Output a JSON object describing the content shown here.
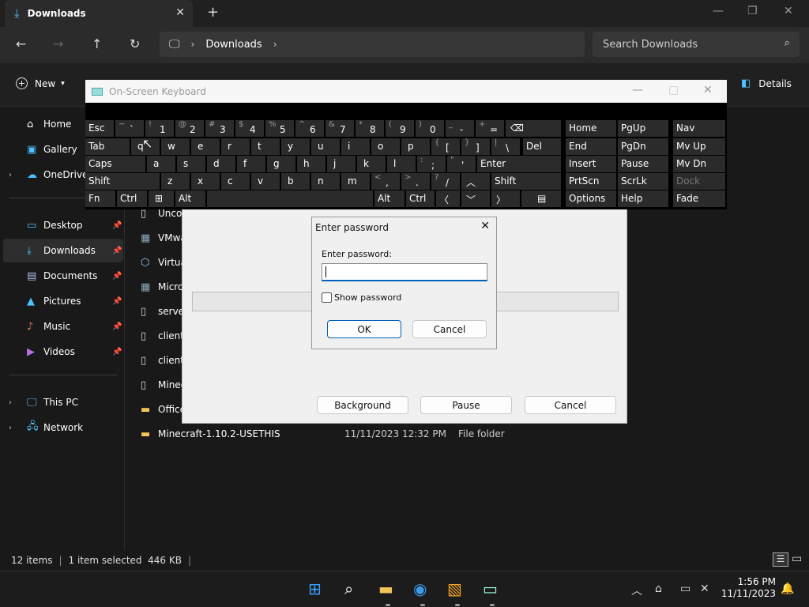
{
  "explorer": {
    "tab_title": "Downloads",
    "breadcrumb": "Downloads",
    "search_placeholder": "Search Downloads",
    "new_label": "New",
    "details_label": "Details",
    "sidebar": [
      {
        "label": "Home",
        "icon": "home-icon"
      },
      {
        "label": "Gallery",
        "icon": "gallery-icon"
      },
      {
        "label": "OneDrive",
        "icon": "onedrive-icon"
      },
      {
        "label": "Desktop",
        "icon": "desktop-icon"
      },
      {
        "label": "Downloads",
        "icon": "download-icon"
      },
      {
        "label": "Documents",
        "icon": "documents-icon"
      },
      {
        "label": "Pictures",
        "icon": "pictures-icon"
      },
      {
        "label": "Music",
        "icon": "music-icon"
      },
      {
        "label": "Videos",
        "icon": "videos-icon"
      },
      {
        "label": "This PC",
        "icon": "pc-icon"
      },
      {
        "label": "Network",
        "icon": "network-icon"
      }
    ],
    "files": [
      {
        "name": "Uncon"
      },
      {
        "name": "VMwa"
      },
      {
        "name": "Virtua"
      },
      {
        "name": "Micro"
      },
      {
        "name": "server"
      },
      {
        "name": "client"
      },
      {
        "name": "client."
      },
      {
        "name": "Minec"
      },
      {
        "name": "Office"
      },
      {
        "name": "Minecraft-1.10.2-USETHIS",
        "date": "11/11/2023 12:32 PM",
        "type": "File folder"
      }
    ],
    "status": {
      "items": "12 items",
      "selected": "1 item selected  446 KB"
    }
  },
  "progress_window": {
    "background_btn": "Background",
    "pause_btn": "Pause",
    "cancel_btn": "Cancel"
  },
  "password_dialog": {
    "title": "Enter password",
    "label": "Enter password:",
    "value": "",
    "show_password": "Show password",
    "show_password_checked": false,
    "ok": "OK",
    "cancel": "Cancel"
  },
  "keyboard": {
    "title": "On-Screen Keyboard",
    "labels": {
      "esc": "Esc",
      "tab": "Tab",
      "caps": "Caps",
      "shift": "Shift",
      "fn": "Fn",
      "ctrl": "Ctrl",
      "alt": "Alt",
      "del": "Del",
      "enter": "Enter",
      "home": "Home",
      "pgup": "PgUp",
      "nav": "Nav",
      "end": "End",
      "pgdn": "PgDn",
      "mvup": "Mv Up",
      "insert": "Insert",
      "pause": "Pause",
      "mvdn": "Mv Dn",
      "prtscn": "PrtScn",
      "scrlk": "ScrLk",
      "dock": "Dock",
      "options": "Options",
      "help": "Help",
      "fade": "Fade"
    },
    "num_row": [
      {
        "u": "~",
        "l": "`"
      },
      {
        "u": "!",
        "l": "1"
      },
      {
        "u": "@",
        "l": "2"
      },
      {
        "u": "#",
        "l": "3"
      },
      {
        "u": "$",
        "l": "4"
      },
      {
        "u": "%",
        "l": "5"
      },
      {
        "u": "^",
        "l": "6"
      },
      {
        "u": "&",
        "l": "7"
      },
      {
        "u": "*",
        "l": "8"
      },
      {
        "u": "(",
        "l": "9"
      },
      {
        "u": ")",
        "l": "0"
      },
      {
        "u": "_",
        "l": "-"
      },
      {
        "u": "+",
        "l": "="
      }
    ],
    "q_row": [
      "q",
      "w",
      "e",
      "r",
      "t",
      "y",
      "u",
      "i",
      "o",
      "p"
    ],
    "q_row_sym": [
      {
        "u": "{",
        "l": "["
      },
      {
        "u": "}",
        "l": "]"
      },
      {
        "u": "|",
        "l": "\\"
      }
    ],
    "a_row": [
      "a",
      "s",
      "d",
      "f",
      "g",
      "h",
      "j",
      "k",
      "l"
    ],
    "a_row_sym": [
      {
        "u": ":",
        "l": ";"
      },
      {
        "u": "\"",
        "l": "'"
      }
    ],
    "z_row": [
      "z",
      "x",
      "c",
      "v",
      "b",
      "n",
      "m"
    ],
    "z_row_sym": [
      {
        "u": "<",
        "l": ","
      },
      {
        "u": ">",
        "l": "."
      },
      {
        "u": "?",
        "l": "/"
      }
    ]
  },
  "taskbar": {
    "time": "1:56 PM",
    "date": "11/11/2023"
  },
  "colors": {
    "accent": "#4cc2ff",
    "dialog_focus": "#005fb8"
  }
}
